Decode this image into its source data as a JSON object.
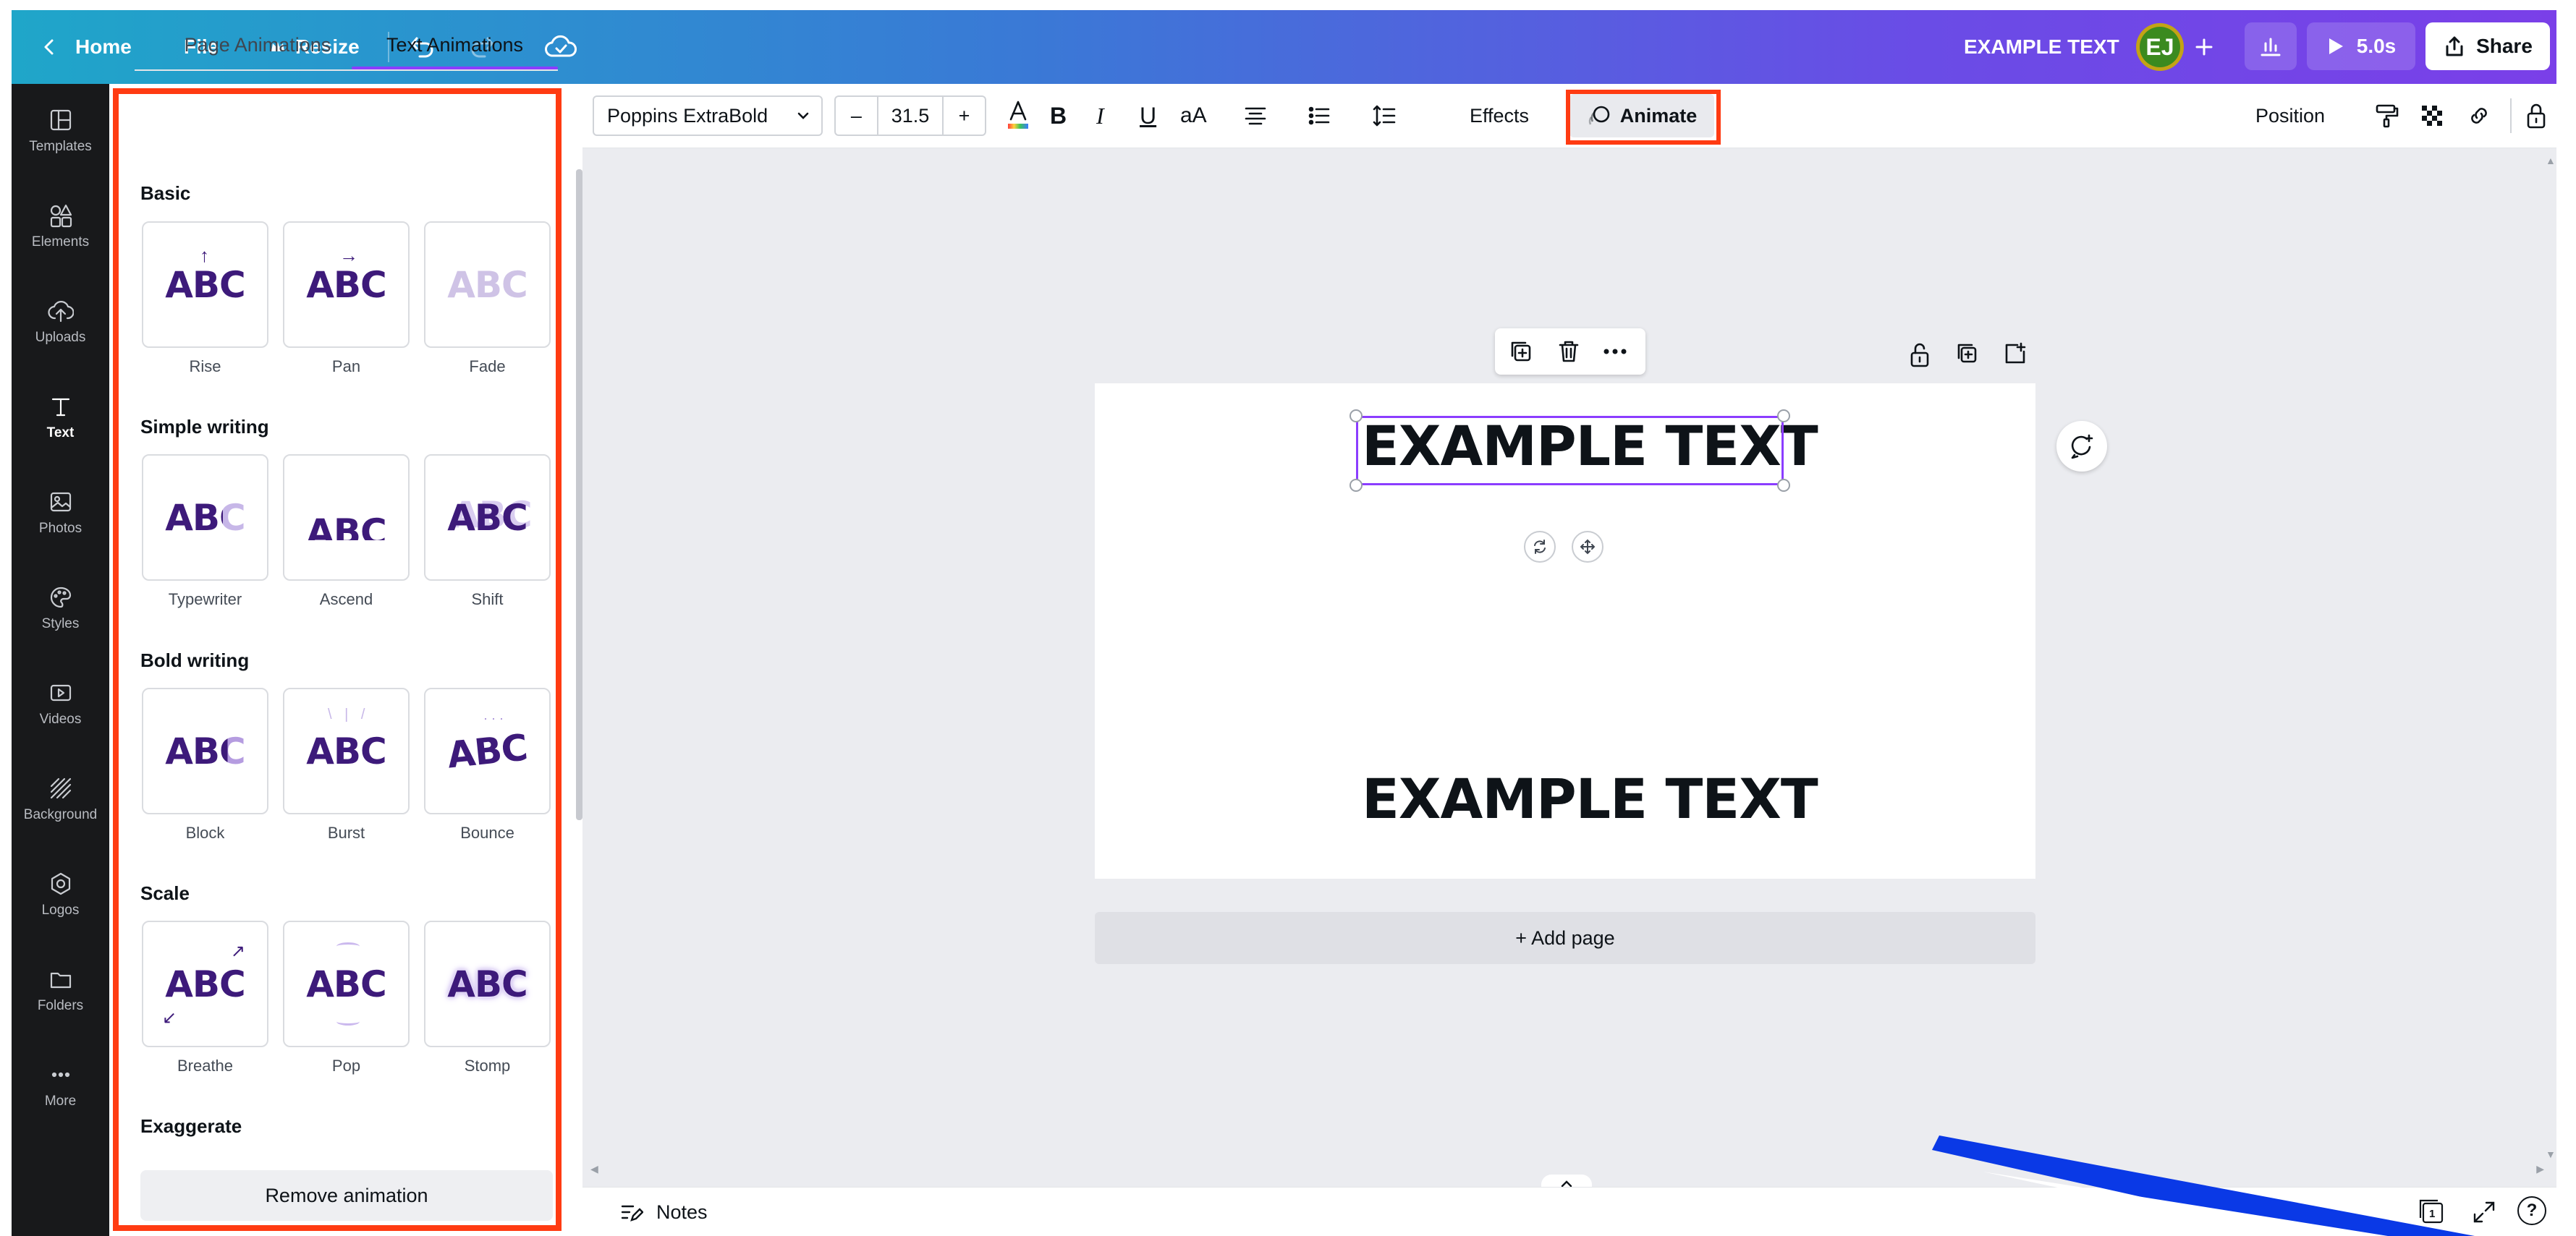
{
  "topbar": {
    "home": "Home",
    "file": "File",
    "resize": "Resize",
    "doc_title": "EXAMPLE TEXT",
    "avatar_initials": "EJ",
    "play_duration": "5.0s",
    "share": "Share"
  },
  "rail": {
    "items": [
      {
        "label": "Templates",
        "icon": "templates-icon"
      },
      {
        "label": "Elements",
        "icon": "elements-icon"
      },
      {
        "label": "Uploads",
        "icon": "upload-icon"
      },
      {
        "label": "Text",
        "icon": "text-icon"
      },
      {
        "label": "Photos",
        "icon": "photos-icon"
      },
      {
        "label": "Styles",
        "icon": "styles-icon"
      },
      {
        "label": "Videos",
        "icon": "videos-icon"
      },
      {
        "label": "Background",
        "icon": "background-icon"
      },
      {
        "label": "Logos",
        "icon": "logos-icon"
      },
      {
        "label": "Folders",
        "icon": "folders-icon"
      },
      {
        "label": "More",
        "icon": "more-icon"
      }
    ]
  },
  "panel": {
    "tabs": [
      "Page Animations",
      "Text Animations"
    ],
    "sections": [
      {
        "title": "Basic",
        "items": [
          "Rise",
          "Pan",
          "Fade"
        ]
      },
      {
        "title": "Simple writing",
        "items": [
          "Typewriter",
          "Ascend",
          "Shift"
        ]
      },
      {
        "title": "Bold writing",
        "items": [
          "Block",
          "Burst",
          "Bounce"
        ]
      },
      {
        "title": "Scale",
        "items": [
          "Breathe",
          "Pop",
          "Stomp"
        ]
      },
      {
        "title": "Exaggerate",
        "items": []
      }
    ],
    "card_glyph": "ABC",
    "remove_animation": "Remove animation"
  },
  "toolbar": {
    "font": "Poppins ExtraBold",
    "font_size": "31.5",
    "minus": "–",
    "plus": "+",
    "case_label": "aA",
    "effects": "Effects",
    "animate": "Animate",
    "position": "Position"
  },
  "canvas": {
    "text_top": "EXAMPLE TEXT",
    "text_bottom": "EXAMPLE TEXT",
    "add_page": "+ Add page"
  },
  "bottombar": {
    "notes": "Notes",
    "page_count": "1",
    "help": "?"
  },
  "colors": {
    "accent": "#8b3dff",
    "highlight": "#ff3b12",
    "card_text": "#3d1a7a"
  }
}
